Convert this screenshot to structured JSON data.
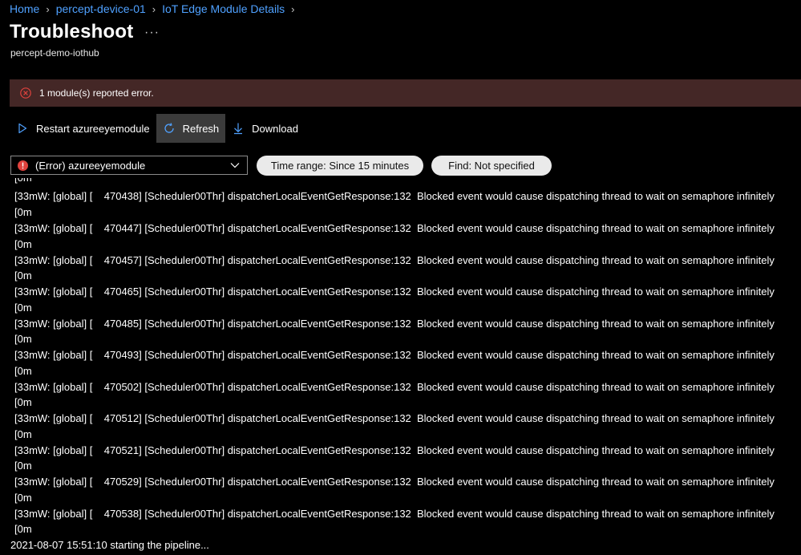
{
  "breadcrumb": {
    "items": [
      "Home",
      "percept-device-01",
      "IoT Edge Module Details"
    ]
  },
  "header": {
    "title": "Troubleshoot",
    "more_label": "···",
    "subtitle": "percept-demo-iothub"
  },
  "banner": {
    "text": "1 module(s) reported error.",
    "icon": "error-circle-icon",
    "background": "#442726"
  },
  "toolbar": {
    "restart_label": "Restart azureeyemodule",
    "refresh_label": "Refresh",
    "download_label": "Download"
  },
  "filters": {
    "module_select_value": "(Error) azureeyemodule",
    "time_range_label": "Time range: Since 15 minutes",
    "find_label": "Find: Not specified"
  },
  "logs": {
    "top_partial": "[0m",
    "entries": [
      {
        "prefix": "[33mW: [global] [    470438] [Scheduler00Thr] dispatcherLocalEventGetResponse:132",
        "message": "Blocked event would cause dispatching thread to wait on semaphore infinitely",
        "suffix": "[0m"
      },
      {
        "prefix": "[33mW: [global] [    470447] [Scheduler00Thr] dispatcherLocalEventGetResponse:132",
        "message": "Blocked event would cause dispatching thread to wait on semaphore infinitely",
        "suffix": "[0m"
      },
      {
        "prefix": "[33mW: [global] [    470457] [Scheduler00Thr] dispatcherLocalEventGetResponse:132",
        "message": "Blocked event would cause dispatching thread to wait on semaphore infinitely",
        "suffix": "[0m"
      },
      {
        "prefix": "[33mW: [global] [    470465] [Scheduler00Thr] dispatcherLocalEventGetResponse:132",
        "message": "Blocked event would cause dispatching thread to wait on semaphore infinitely",
        "suffix": "[0m"
      },
      {
        "prefix": "[33mW: [global] [    470485] [Scheduler00Thr] dispatcherLocalEventGetResponse:132",
        "message": "Blocked event would cause dispatching thread to wait on semaphore infinitely",
        "suffix": "[0m"
      },
      {
        "prefix": "[33mW: [global] [    470493] [Scheduler00Thr] dispatcherLocalEventGetResponse:132",
        "message": "Blocked event would cause dispatching thread to wait on semaphore infinitely",
        "suffix": "[0m"
      },
      {
        "prefix": "[33mW: [global] [    470502] [Scheduler00Thr] dispatcherLocalEventGetResponse:132",
        "message": "Blocked event would cause dispatching thread to wait on semaphore infinitely",
        "suffix": "[0m"
      },
      {
        "prefix": "[33mW: [global] [    470512] [Scheduler00Thr] dispatcherLocalEventGetResponse:132",
        "message": "Blocked event would cause dispatching thread to wait on semaphore infinitely",
        "suffix": "[0m"
      },
      {
        "prefix": "[33mW: [global] [    470521] [Scheduler00Thr] dispatcherLocalEventGetResponse:132",
        "message": "Blocked event would cause dispatching thread to wait on semaphore infinitely",
        "suffix": "[0m"
      },
      {
        "prefix": "[33mW: [global] [    470529] [Scheduler00Thr] dispatcherLocalEventGetResponse:132",
        "message": "Blocked event would cause dispatching thread to wait on semaphore infinitely",
        "suffix": "[0m"
      },
      {
        "prefix": "[33mW: [global] [    470538] [Scheduler00Thr] dispatcherLocalEventGetResponse:132",
        "message": "Blocked event would cause dispatching thread to wait on semaphore infinitely",
        "suffix": "[0m"
      }
    ],
    "last_line": "2021-08-07 15:51:10 starting the pipeline..."
  },
  "colors": {
    "background": "#000000",
    "link": "#4fa1ff",
    "error_banner": "#442726",
    "error_red": "#e0423d",
    "accent_blue": "#4fa1ff",
    "pill_bg": "#eaeaea"
  }
}
